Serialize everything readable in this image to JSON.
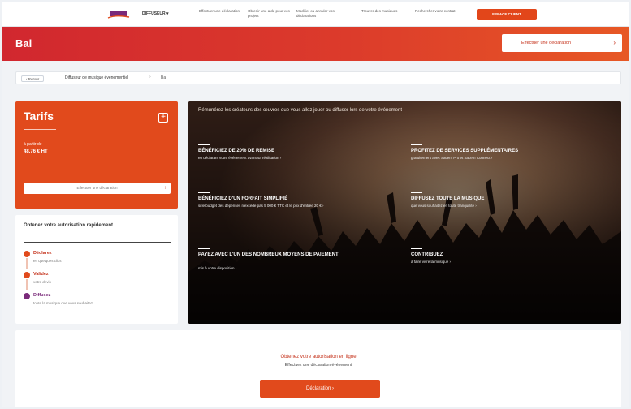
{
  "nav": {
    "dropdown_label": "DIFFUSEUR ▾",
    "items": [
      "Effectuer une déclaration",
      "Obtenir une aide pour vos projets",
      "Modifier ou annuler vos déclarations",
      "Trouver des musiques",
      "Rechercher votre contrat"
    ],
    "cta": "ESPACE CLIENT",
    "colors": {
      "accent": "#e14a1c",
      "brand_purple": "#7a2a7a"
    }
  },
  "banner": {
    "title": "Bal",
    "button_label": "Effectuer une déclaration"
  },
  "breadcrumb": {
    "back": "‹ Retour",
    "link": "Diffuseur de musique événementiel",
    "separator": "›",
    "current": "Bal"
  },
  "tarifs": {
    "title": "Tarifs",
    "plus": "+",
    "from_label": "à partir de",
    "price": "48,76 € HT",
    "button_label": "Effectuer une déclaration"
  },
  "steps": {
    "title": "Obtenez votre autorisation rapidement",
    "items": [
      {
        "name": "Déclarez",
        "desc": "en quelques clics"
      },
      {
        "name": "Validez",
        "desc": "votre devis"
      },
      {
        "name": "Diffusez",
        "desc": "toute la musique que vous souhaitez"
      }
    ]
  },
  "hero": {
    "headline": "Rémunérez les créateurs des œuvres que vous allez jouer ou diffuser lors de votre événement !",
    "features": [
      {
        "title": "BÉNÉFICIEZ DE 20% DE REMISE",
        "link": "en déclarant votre événement avant sa réalisation ›"
      },
      {
        "title": "PROFITEZ DE SERVICES SUPPLÉMENTAIRES",
        "link": "gratuitement avec Sacem Pro et Sacem Connect ›"
      },
      {
        "title": "BÉNÉFICIEZ D'UN FORFAIT SIMPLIFIÉ",
        "link": "si le budget des dépenses n'excède pas 5 000 € TTC et le prix d'entrée 20 € ›"
      },
      {
        "title": "DIFFUSEZ TOUTE LA MUSIQUE",
        "link": "que vous souhaitez en toute tranquillité ›"
      },
      {
        "title": "PAYEZ AVEC L'UN DES NOMBREUX MOYENS DE PAIEMENT",
        "link": "mis à votre disposition ›"
      },
      {
        "title": "CONTRIBUEZ",
        "link": "à faire vivre la musique ›"
      }
    ]
  },
  "bottom": {
    "title": "Obtenez votre autorisation en ligne",
    "subtitle": "Effectuez une déclaration événement",
    "button_label": "Déclaration ›"
  }
}
